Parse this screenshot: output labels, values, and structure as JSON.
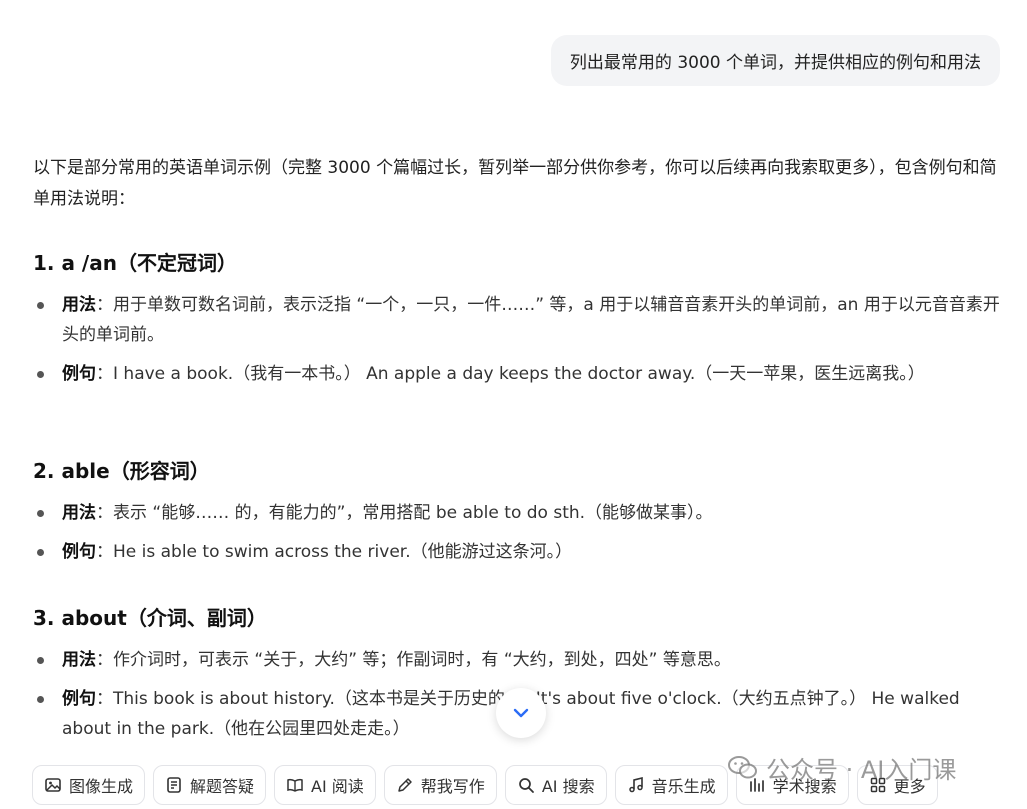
{
  "user_message": "列出最常用的 3000 个单词，并提供相应的例句和用法",
  "answer": {
    "intro": "以下是部分常用的英语单词示例（完整 3000 个篇幅过长，暂列举一部分供你参考，你可以后续再向我索取更多），包含例句和简单用法说明：",
    "entries": [
      {
        "title": "1. a /an（不定冠词）",
        "usage_label": "用法",
        "usage": "：用于单数可数名词前，表示泛指 “一个，一只，一件……” 等，a 用于以辅音音素开头的单词前，an 用于以元音音素开头的单词前。",
        "example_label": "例句",
        "example": "：I have a book.（我有一本书。） An apple a day keeps the doctor away.（一天一苹果，医生远离我。）"
      },
      {
        "title": "2. able（形容词）",
        "usage_label": "用法",
        "usage": "：表示 “能够…… 的，有能力的”，常用搭配 be able to do sth.（能够做某事）。",
        "example_label": "例句",
        "example": "：He is able to swim across the river.（他能游过这条河。）"
      },
      {
        "title": "3. about（介词、副词）",
        "usage_label": "用法",
        "usage": "：作介词时，可表示 “关于，大约” 等；作副词时，有 “大约，到处，四处” 等意思。",
        "example_label": "例句",
        "example": "：This book is about history.（这本书是关于历史的。） It's about five o'clock.（大约五点钟了。） He walked about in the park.（他在公园里四处走走。）"
      }
    ]
  },
  "toolbar": {
    "items": [
      {
        "label": "图像生成",
        "icon": "image-icon"
      },
      {
        "label": "解题答疑",
        "icon": "question-icon"
      },
      {
        "label": "AI 阅读",
        "icon": "book-icon"
      },
      {
        "label": "帮我写作",
        "icon": "pen-icon"
      },
      {
        "label": "AI 搜索",
        "icon": "search-icon"
      },
      {
        "label": "音乐生成",
        "icon": "music-icon"
      },
      {
        "label": "学术搜索",
        "icon": "academic-icon"
      },
      {
        "label": "更多",
        "icon": "grid-icon"
      }
    ]
  },
  "watermark": {
    "text": "公众号 · AI入门课"
  }
}
